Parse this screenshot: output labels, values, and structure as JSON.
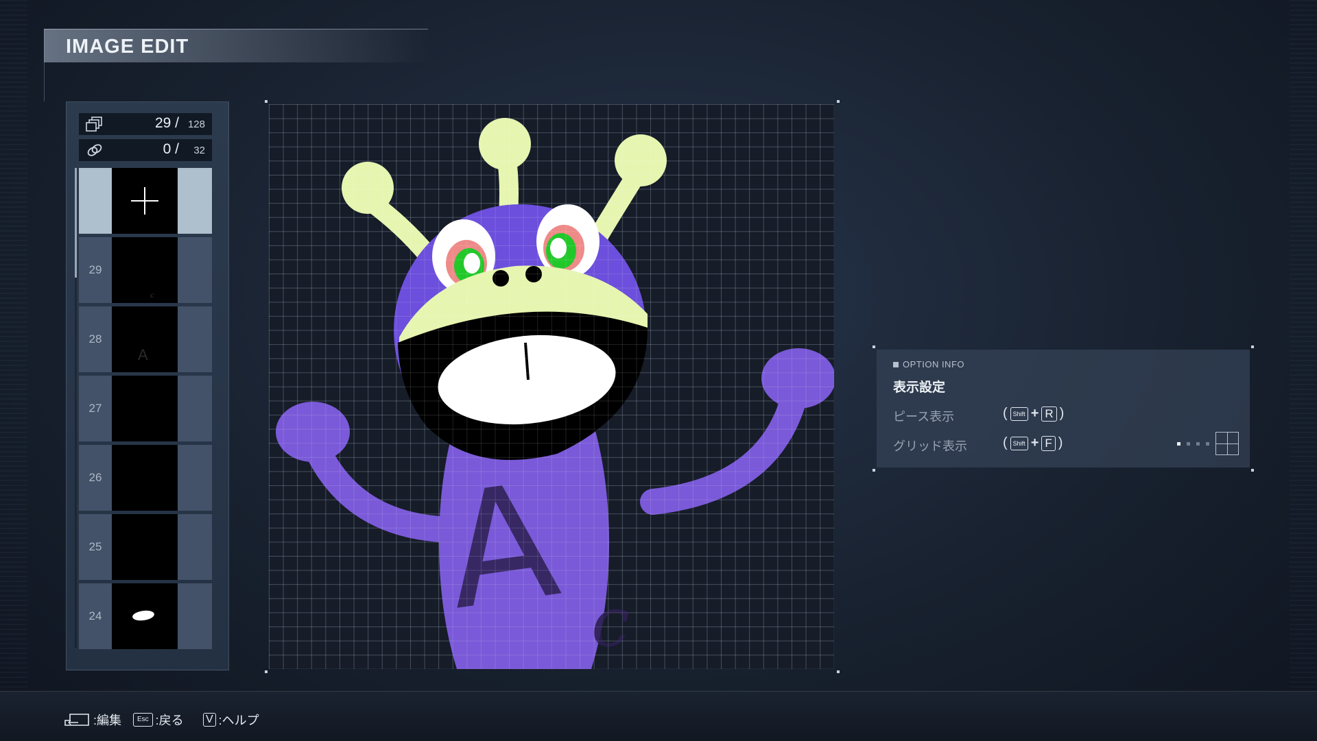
{
  "header": {
    "title": "IMAGE EDIT"
  },
  "left_panel": {
    "piece_counter": {
      "icon": "layers-icon",
      "current": "29 /",
      "max": "128"
    },
    "link_counter": {
      "icon": "link-icon",
      "current": "0 /",
      "max": "32"
    },
    "add_slot": {
      "icon": "plus-icon"
    },
    "layers": [
      {
        "label": "29"
      },
      {
        "label": "28",
        "preview_text": "A"
      },
      {
        "label": "27"
      },
      {
        "label": "26"
      },
      {
        "label": "25"
      },
      {
        "label": "24"
      }
    ]
  },
  "canvas": {
    "letter_big": "A",
    "letter_small": "c",
    "colors": {
      "body": "#7a5ad8",
      "head": "#6c4fdc",
      "antenna": "#e6f5b0",
      "background": "#161c28"
    }
  },
  "option_info": {
    "heading": "OPTION INFO",
    "title": "表示設定",
    "rows": [
      {
        "label": "ピース表示",
        "open": "(",
        "modifier": "Shift",
        "plus": "+",
        "key": "R",
        "close": ")"
      },
      {
        "label": "グリッド表示",
        "open": "(",
        "modifier": "Shift",
        "plus": "+",
        "key": "F",
        "close": ")"
      }
    ],
    "grid_level": 1,
    "grid_levels_total": 4
  },
  "bottom_bar": {
    "hints": [
      {
        "key_icon": "enter-key-icon",
        "label": ":編集"
      },
      {
        "key": "Esc",
        "label": ":戻る"
      },
      {
        "key": "V",
        "label": ":ヘルプ"
      }
    ]
  }
}
